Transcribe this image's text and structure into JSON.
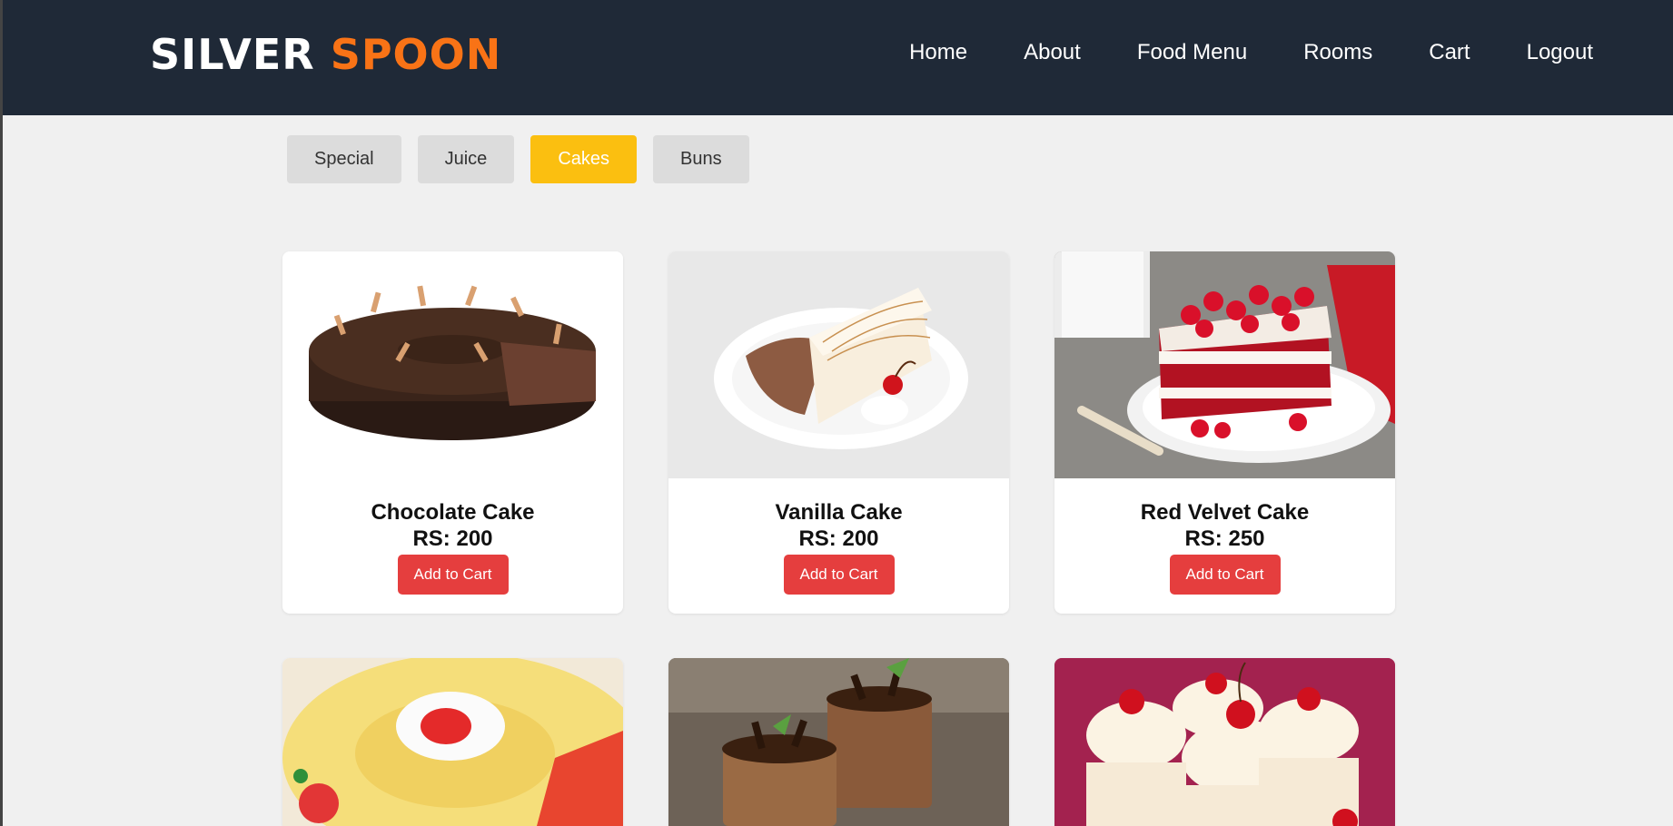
{
  "brand": {
    "part1": "SILVER",
    "part2": "SPOON"
  },
  "nav": [
    "Home",
    "About",
    "Food Menu",
    "Rooms",
    "Cart",
    "Logout"
  ],
  "categories": [
    {
      "label": "Special",
      "active": false
    },
    {
      "label": "Juice",
      "active": false
    },
    {
      "label": "Cakes",
      "active": true
    },
    {
      "label": "Buns",
      "active": false
    }
  ],
  "products": [
    {
      "name": "Chocolate Cake",
      "price": "RS: 200",
      "button": "Add to Cart",
      "image": "chocolate-cake-image"
    },
    {
      "name": "Vanilla Cake",
      "price": "RS: 200",
      "button": "Add to Cart",
      "image": "vanilla-cake-image"
    },
    {
      "name": "Red Velvet Cake",
      "price": "RS: 250",
      "button": "Add to Cart",
      "image": "red-velvet-cake-image"
    },
    {
      "image": "swiss-roll-image"
    },
    {
      "image": "mini-chocolate-cakes-image"
    },
    {
      "image": "cherry-cupcakes-image"
    }
  ],
  "colors": {
    "header_bg": "#1f2937",
    "brand_accent": "#f97316",
    "active_tab": "#fbbf10",
    "add_button": "#e53e3e"
  }
}
